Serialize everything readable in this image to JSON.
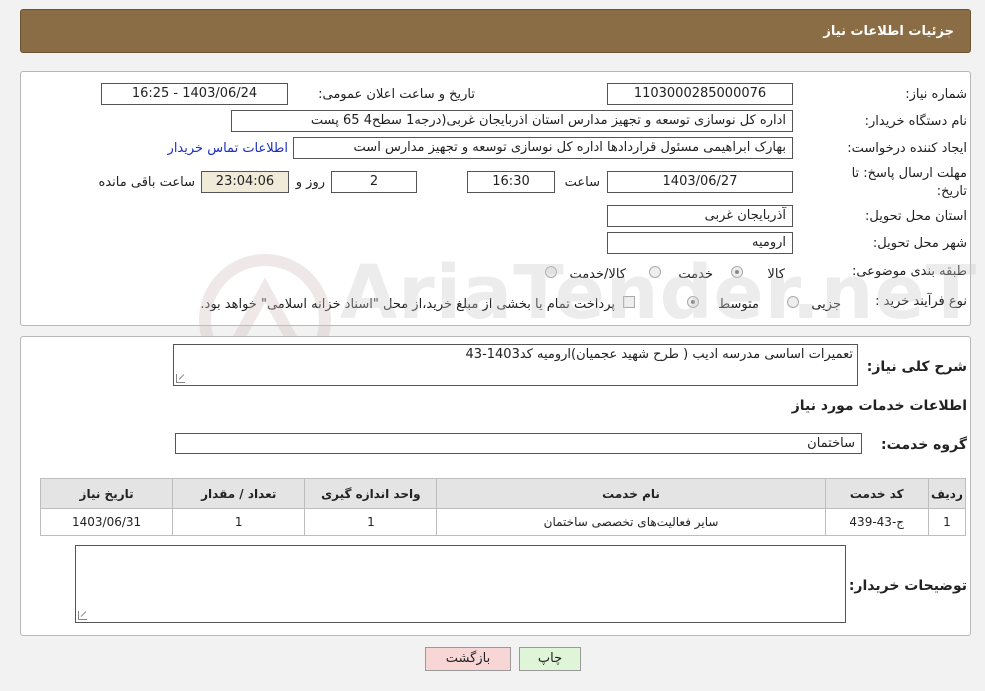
{
  "header": {
    "title": "جزئیات اطلاعات نیاز"
  },
  "form": {
    "need_number_label": "شماره نیاز:",
    "need_number": "1103000285000076",
    "announce_label": "تاریخ و ساعت اعلان عمومی:",
    "announce_value": "1403/06/24 - 16:25",
    "buyer_org_label": "نام دستگاه خریدار:",
    "buyer_org": "اداره کل نوسازی   توسعه و تجهیز مدارس استان اذربایجان غربی(درجه1  سطح4  65 پست",
    "creator_label": "ایجاد کننده درخواست:",
    "creator": "بهارک ابراهیمی مسئول قراردادها اداره کل نوسازی   توسعه و تجهیز مدارس است",
    "contact_link": "اطلاعات تماس خریدار",
    "deadline_label": "مهلت ارسال پاسخ: تا تاریخ:",
    "deadline_date": "1403/06/27",
    "time_label": "ساعت",
    "deadline_time": "16:30",
    "days_value": "2",
    "days_label": "روز و",
    "remaining_time": "23:04:06",
    "remaining_label": "ساعت باقی مانده",
    "province_label": "استان محل تحویل:",
    "province": "آذربایجان غربی",
    "city_label": "شهر محل تحویل:",
    "city": "ارومیه",
    "category_label": "طبقه بندی موضوعی:",
    "category_options": [
      "کالا",
      "خدمت",
      "کالا/خدمت"
    ],
    "process_label": "نوع فرآیند خرید :",
    "process_options": [
      "جزیی",
      "متوسط"
    ],
    "payment_note": "پرداخت تمام یا بخشی از مبلغ خرید،از محل \"اسناد خزانه اسلامی\" خواهد بود."
  },
  "details": {
    "summary_label": "شرح کلی نیاز:",
    "summary": "تعمیرات اساسی مدرسه ادیب ( طرح شهید عجمیان)ارومیه کد1403-43",
    "services_title": "اطلاعات خدمات مورد نیاز",
    "service_group_label": "گروه خدمت:",
    "service_group": "ساختمان",
    "table": {
      "headers": [
        "ردیف",
        "کد خدمت",
        "نام خدمت",
        "واحد اندازه گیری",
        "تعداد / مقدار",
        "تاریخ نیاز"
      ],
      "rows": [
        [
          "1",
          "ج-43-439",
          "سایر فعالیت‌های تخصصی ساختمان",
          "1",
          "1",
          "1403/06/31"
        ]
      ]
    },
    "buyer_notes_label": "توضیحات خریدار:",
    "buyer_notes": ""
  },
  "buttons": {
    "print": "چاپ",
    "back": "بازگشت"
  },
  "watermark": "AriaTender.neT"
}
